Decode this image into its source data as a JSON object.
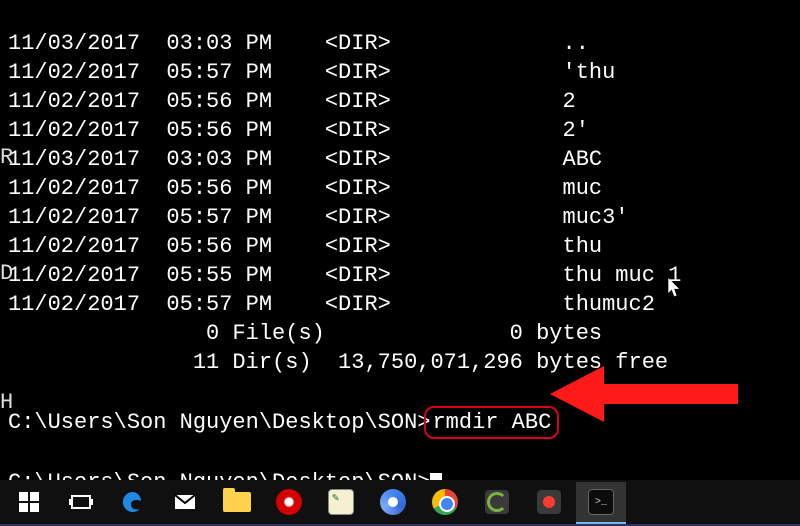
{
  "listing": [
    {
      "date": "11/03/2017",
      "time": "03:03 PM",
      "type": "<DIR>",
      "name": ".."
    },
    {
      "date": "11/02/2017",
      "time": "05:57 PM",
      "type": "<DIR>",
      "name": "'thu"
    },
    {
      "date": "11/02/2017",
      "time": "05:56 PM",
      "type": "<DIR>",
      "name": "2"
    },
    {
      "date": "11/02/2017",
      "time": "05:56 PM",
      "type": "<DIR>",
      "name": "2'"
    },
    {
      "date": "11/03/2017",
      "time": "03:03 PM",
      "type": "<DIR>",
      "name": "ABC"
    },
    {
      "date": "11/02/2017",
      "time": "05:56 PM",
      "type": "<DIR>",
      "name": "muc"
    },
    {
      "date": "11/02/2017",
      "time": "05:57 PM",
      "type": "<DIR>",
      "name": "muc3'"
    },
    {
      "date": "11/02/2017",
      "time": "05:56 PM",
      "type": "<DIR>",
      "name": "thu"
    },
    {
      "date": "11/02/2017",
      "time": "05:55 PM",
      "type": "<DIR>",
      "name": "thu muc 1"
    },
    {
      "date": "11/02/2017",
      "time": "05:57 PM",
      "type": "<DIR>",
      "name": "thumuc2"
    }
  ],
  "summary": {
    "files_line": "               0 File(s)              0 bytes",
    "dirs_line": "              11 Dir(s)  13,750,071,296 bytes free"
  },
  "prompt1_path": "C:\\Users\\Son Nguyen\\Desktop\\SON>",
  "prompt1_cmd": "rmdir ABC",
  "prompt2_path": "C:\\Users\\Son Nguyen\\Desktop\\SON>",
  "edge_letters": {
    "l5": "R",
    "l9": "D",
    "l12": "H"
  },
  "taskbar": {
    "items": [
      {
        "name": "start",
        "interact": true
      },
      {
        "name": "task-view",
        "interact": true
      },
      {
        "name": "edge",
        "interact": true
      },
      {
        "name": "mail",
        "interact": true
      },
      {
        "name": "file-explorer",
        "interact": true
      },
      {
        "name": "garena",
        "interact": true
      },
      {
        "name": "notepadpp",
        "interact": true
      },
      {
        "name": "chromium",
        "interact": true
      },
      {
        "name": "chrome",
        "interact": true
      },
      {
        "name": "camtasia",
        "interact": true
      },
      {
        "name": "recorder",
        "interact": true
      },
      {
        "name": "cmd",
        "interact": true,
        "active": true
      }
    ]
  }
}
